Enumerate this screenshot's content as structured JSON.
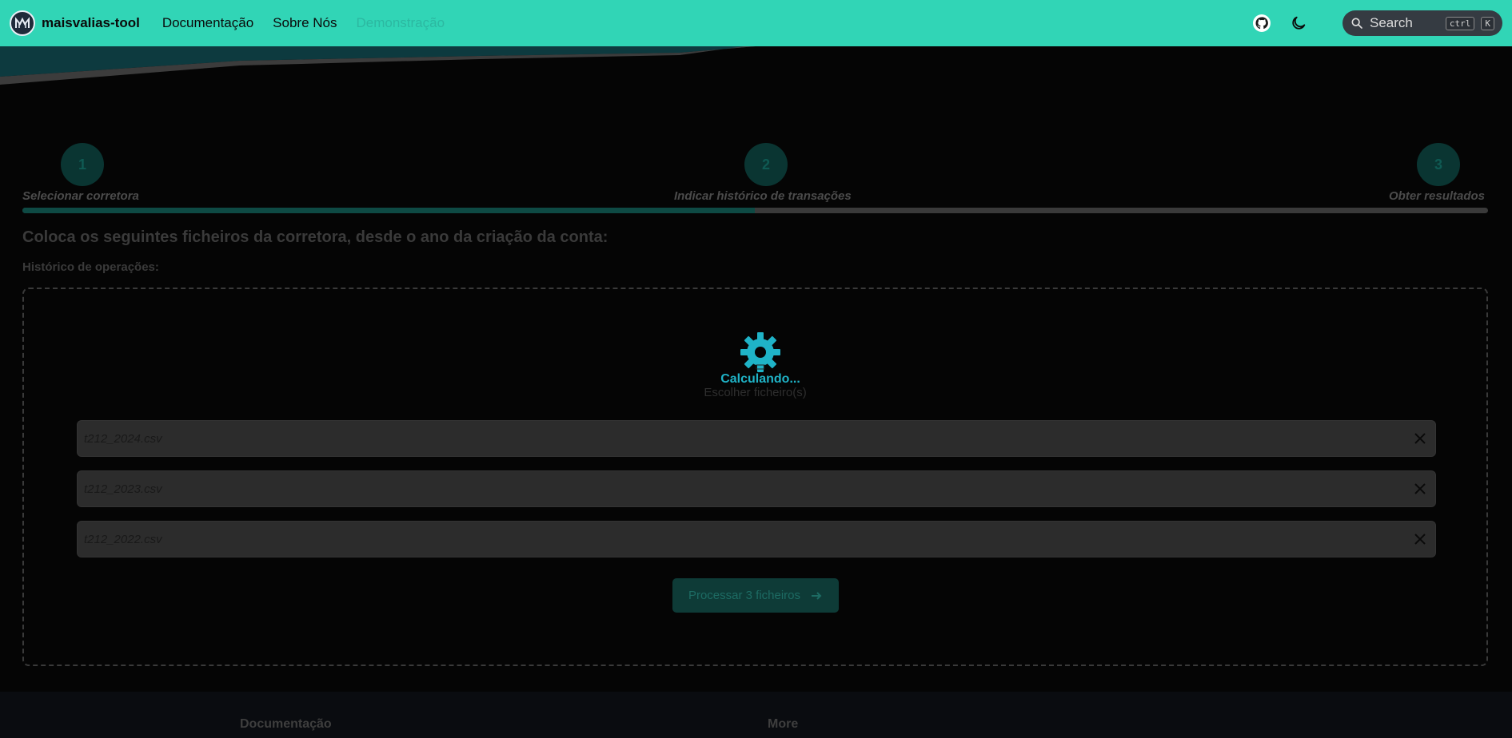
{
  "navbar": {
    "brand": "maisvalias-tool",
    "links": [
      "Documentação",
      "Sobre Nós",
      "Demonstração"
    ],
    "search_placeholder": "Search",
    "kbd_ctrl": "ctrl",
    "kbd_k": "K"
  },
  "steps": [
    {
      "number": "1",
      "label": "Selecionar corretora"
    },
    {
      "number": "2",
      "label": "Indicar histórico de transações"
    },
    {
      "number": "3",
      "label": "Obter resultados"
    }
  ],
  "main": {
    "heading": "Coloca os seguintes ficheiros da corretora, desde o ano da criação da conta:",
    "subheading": "Histórico de operações:",
    "choose_files": "Escolher ficheiro(s)",
    "files": [
      "t212_2024.csv",
      "t212_2023.csv",
      "t212_2022.csv"
    ],
    "process_button": "Processar 3 ficheiros"
  },
  "loader": {
    "text": "Calculando..."
  },
  "footer": {
    "col1_title": "Documentação",
    "col2_title": "More"
  },
  "colors": {
    "navbar": "#31d5b6",
    "accent": "#1fb3c7",
    "background": "#050505"
  }
}
